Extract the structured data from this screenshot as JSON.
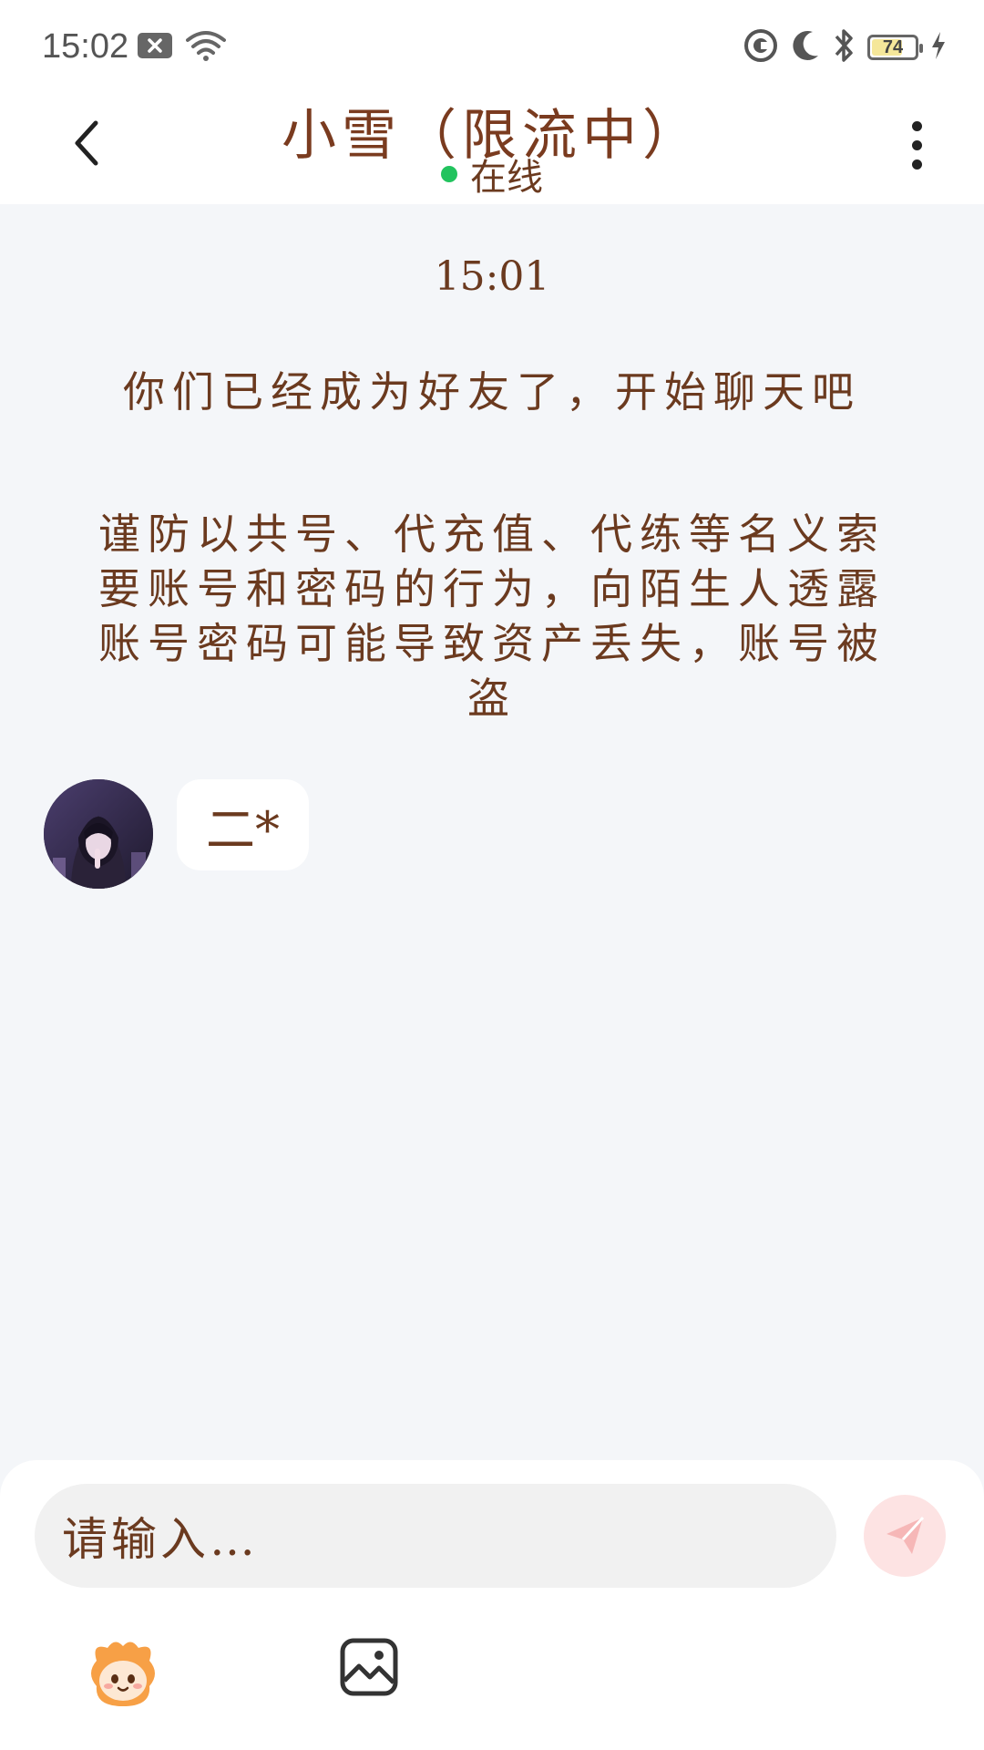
{
  "status_bar": {
    "time": "15:02",
    "battery_level": "74",
    "battery_fraction": 0.74,
    "icons": [
      "notification-x-icon",
      "wifi-icon",
      "record-icon",
      "moon-icon",
      "bluetooth-icon",
      "battery-icon",
      "charging-bolt-icon"
    ]
  },
  "header": {
    "title": "小雪（限流中）",
    "status": "在线",
    "status_color": "#22c35e",
    "back_icon": "chevron-left-icon",
    "more_icon": "more-vertical-icon"
  },
  "messages": {
    "timestamp": "15:01",
    "friend_notice": "你们已经成为好友了，开始聊天吧",
    "warning_notice": "谨防以共号、代充值、代练等名义索要账号和密码的行为，向陌生人透露账号密码可能导致资产丢失，账号被盗",
    "received": [
      {
        "text": "二*"
      }
    ]
  },
  "composer": {
    "placeholder": "请输入…",
    "send_icon": "send-plane-icon",
    "emoji_icon": "emoji-mascot-icon",
    "image_icon": "image-icon"
  },
  "colors": {
    "text_brown": "#6b3a1f",
    "background": "#f4f6f9",
    "send_disabled": "#fde3e3"
  }
}
